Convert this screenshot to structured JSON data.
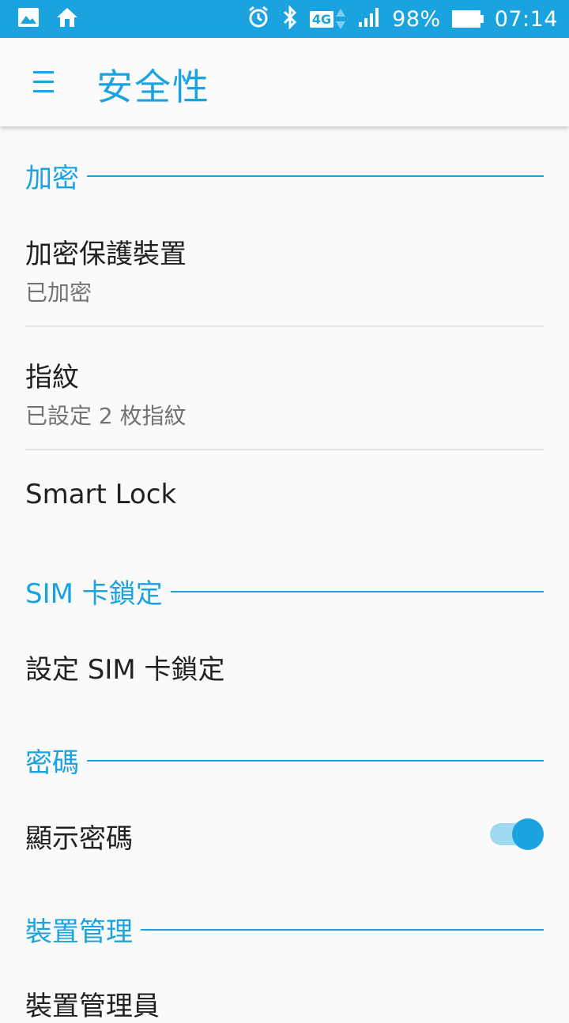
{
  "status_bar": {
    "network": "4G",
    "battery": "98%",
    "time": "07:14",
    "icons": [
      "image-icon",
      "home-icon",
      "alarm-icon",
      "bluetooth-icon",
      "lte-icon",
      "signal-icon",
      "battery-icon"
    ]
  },
  "toolbar": {
    "title": "安全性",
    "menu_icon": "menu-icon"
  },
  "sections": {
    "encryption": {
      "header": "加密",
      "encrypt_device": {
        "title": "加密保護裝置",
        "summary": "已加密"
      },
      "fingerprint": {
        "title": "指紋",
        "summary": "已設定 2 枚指紋"
      },
      "smart_lock": {
        "title": "Smart Lock"
      }
    },
    "sim_lock": {
      "header": "SIM 卡鎖定",
      "setup": {
        "title": "設定 SIM 卡鎖定"
      }
    },
    "passwords": {
      "header": "密碼",
      "show_password": {
        "title": "顯示密碼",
        "enabled": true
      }
    },
    "device_admin": {
      "header": "裝置管理",
      "admins": {
        "title": "裝置管理員"
      }
    }
  },
  "colors": {
    "accent": "#1aa3df",
    "toggle_track": "#9fdaf3",
    "primary_text": "#212121",
    "secondary_text": "#737373"
  }
}
